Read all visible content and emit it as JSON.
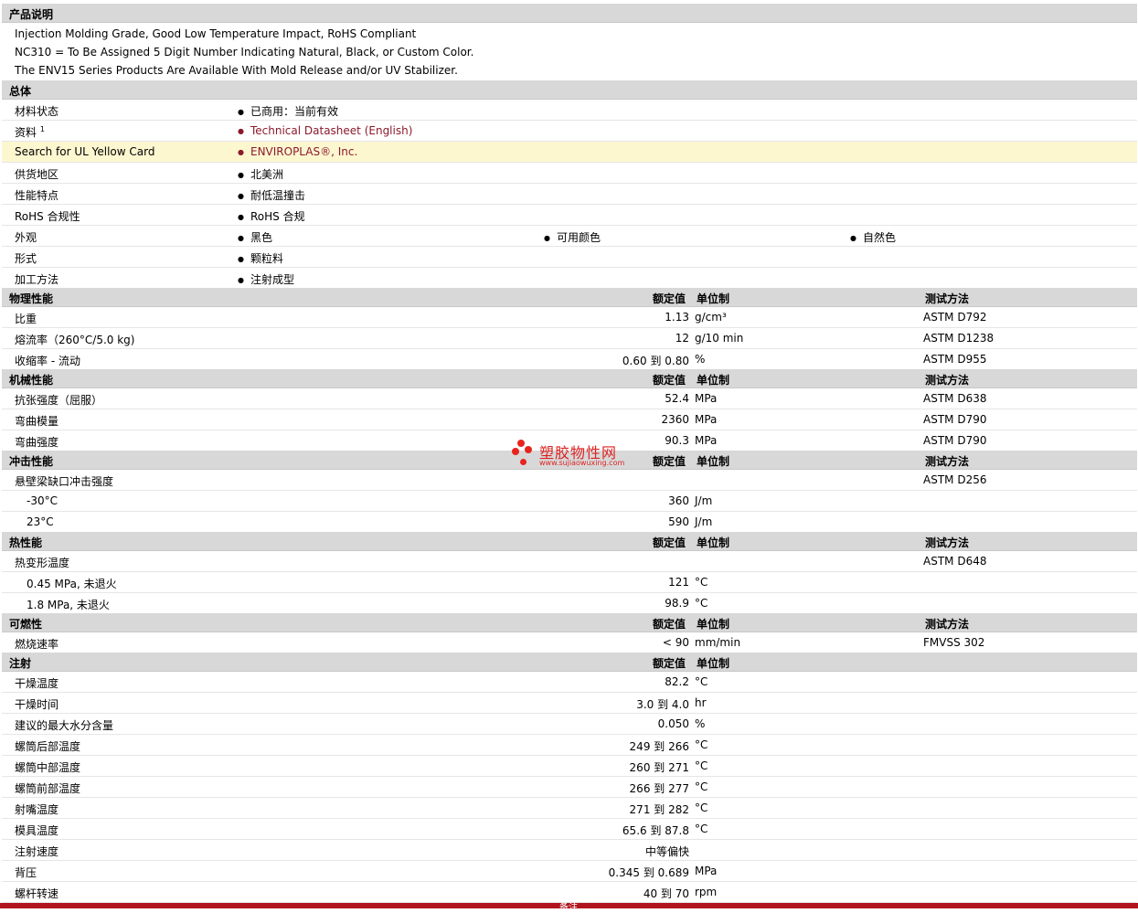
{
  "desc": {
    "title": "产品说明",
    "lines": [
      "Injection Molding Grade, Good Low Temperature Impact, RoHS Compliant",
      "NC310 = To Be Assigned 5 Digit Number Indicating Natural, Black, or Custom Color.",
      "The ENV15 Series Products Are Available With Mold Release and/or UV Stabilizer."
    ]
  },
  "general": {
    "title": "总体",
    "rows": [
      {
        "label": "材料状态",
        "items": [
          "已商用：当前有效"
        ]
      },
      {
        "label": "资料",
        "sup": "1",
        "items": [
          "Technical Datasheet (English)"
        ]
      },
      {
        "label": "Search for UL Yellow Card",
        "items": [
          "ENVIROPLAS®, Inc."
        ]
      },
      {
        "label": "供货地区",
        "items": [
          "北美洲"
        ]
      },
      {
        "label": "性能特点",
        "items": [
          "耐低温撞击"
        ]
      },
      {
        "label": "RoHS 合规性",
        "items": [
          "RoHS 合规"
        ]
      },
      {
        "label": "外观",
        "items": [
          "黑色",
          "可用颜色",
          "自然色"
        ]
      },
      {
        "label": "形式",
        "items": [
          "颗粒料"
        ]
      },
      {
        "label": "加工方法",
        "items": [
          "注射成型"
        ]
      }
    ]
  },
  "headers": {
    "value": "额定值",
    "unit": "单位制",
    "test": "测试方法"
  },
  "physical": {
    "title": "物理性能",
    "rows": [
      {
        "label": "比重",
        "value": "1.13",
        "unit": "g/cm³",
        "test": "ASTM D792"
      },
      {
        "label": "熔流率（260°C/5.0 kg)",
        "value": "12",
        "unit": "g/10 min",
        "test": "ASTM D1238"
      },
      {
        "label": "收缩率 - 流动",
        "value": "0.60 到  0.80",
        "unit": "%",
        "test": "ASTM D955"
      }
    ]
  },
  "mechanical": {
    "title": "机械性能",
    "rows": [
      {
        "label": "抗张强度（屈服）",
        "value": "52.4",
        "unit": "MPa",
        "test": "ASTM D638"
      },
      {
        "label": "弯曲模量",
        "value": "2360",
        "unit": "MPa",
        "test": "ASTM D790"
      },
      {
        "label": "弯曲强度",
        "value": "90.3",
        "unit": "MPa",
        "test": "ASTM D790"
      }
    ]
  },
  "impact": {
    "title": "冲击性能",
    "rows": [
      {
        "label": "悬壁梁缺口冲击强度",
        "value": "",
        "unit": "",
        "test": "ASTM D256"
      },
      {
        "label": "-30°C",
        "sub": true,
        "value": "360",
        "unit": "J/m",
        "test": ""
      },
      {
        "label": "23°C",
        "sub": true,
        "value": "590",
        "unit": "J/m",
        "test": ""
      }
    ]
  },
  "thermal": {
    "title": "热性能",
    "rows": [
      {
        "label": "热变形温度",
        "value": "",
        "unit": "",
        "test": "ASTM D648"
      },
      {
        "label": "0.45 MPa, 未退火",
        "sub": true,
        "value": "121",
        "unit": "°C",
        "test": ""
      },
      {
        "label": "1.8 MPa, 未退火",
        "sub": true,
        "value": "98.9",
        "unit": "°C",
        "test": ""
      }
    ]
  },
  "flammability": {
    "title": "可燃性",
    "rows": [
      {
        "label": "燃烧速率",
        "value": "< 90",
        "unit": "mm/min",
        "test": "FMVSS 302"
      }
    ]
  },
  "injection": {
    "title": "注射",
    "rows": [
      {
        "label": "干燥温度",
        "value": "82.2",
        "unit": "°C"
      },
      {
        "label": "干燥时间",
        "value": "3.0 到  4.0",
        "unit": "hr"
      },
      {
        "label": "建议的最大水分含量",
        "value": "0.050",
        "unit": "%"
      },
      {
        "label": "螺筒后部温度",
        "value": "249 到  266",
        "unit": "°C"
      },
      {
        "label": "螺筒中部温度",
        "value": "260 到  271",
        "unit": "°C"
      },
      {
        "label": "螺筒前部温度",
        "value": "266 到  277",
        "unit": "°C"
      },
      {
        "label": "射嘴温度",
        "value": "271 到  282",
        "unit": "°C"
      },
      {
        "label": "模具温度",
        "value": "65.6 到  87.8",
        "unit": "°C"
      },
      {
        "label": "注射速度",
        "value": "中等偏快",
        "unit": ""
      },
      {
        "label": "背压",
        "value": "0.345 到  0.689",
        "unit": "MPa"
      },
      {
        "label": "螺杆转速",
        "value": "40 到  70",
        "unit": "rpm"
      }
    ]
  },
  "watermark": {
    "title": "塑胶物性网",
    "url": "www.sujiaowuxing.com"
  },
  "footer": {
    "label": "备注"
  }
}
